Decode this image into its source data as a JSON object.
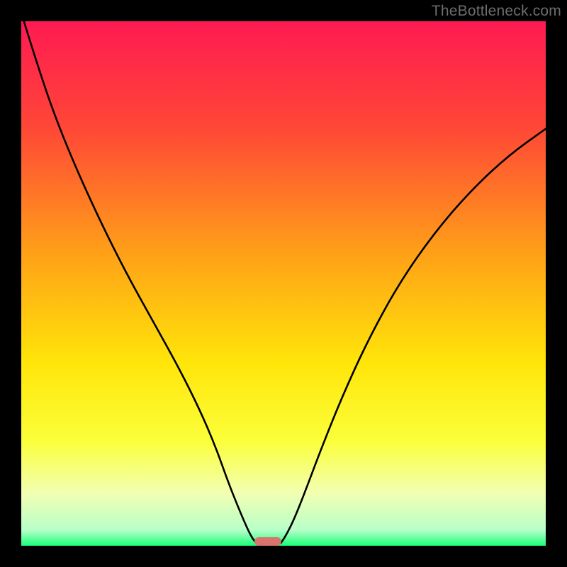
{
  "watermark": "TheBottleneck.com",
  "chart_data": {
    "type": "line",
    "title": "",
    "xlabel": "",
    "ylabel": "",
    "xlim": [
      0,
      100
    ],
    "ylim": [
      0,
      100
    ],
    "gradient_stops": [
      {
        "pct": 0,
        "color": "#ff1a52"
      },
      {
        "pct": 20,
        "color": "#ff4637"
      },
      {
        "pct": 45,
        "color": "#ffa317"
      },
      {
        "pct": 65,
        "color": "#ffe509"
      },
      {
        "pct": 80,
        "color": "#fbff3a"
      },
      {
        "pct": 90,
        "color": "#f2ffb3"
      },
      {
        "pct": 97,
        "color": "#b8ffc9"
      },
      {
        "pct": 100,
        "color": "#19ff79"
      }
    ],
    "series": [
      {
        "name": "left-branch",
        "x": [
          0.5,
          3,
          6,
          10,
          15,
          20,
          25,
          30,
          34,
          37,
          39.5,
          41.5,
          43,
          44,
          44.8
        ],
        "y": [
          100,
          92,
          83,
          73,
          62,
          52,
          43,
          34,
          26,
          19,
          12,
          7,
          3.5,
          1.5,
          0.5
        ]
      },
      {
        "name": "right-branch",
        "x": [
          49.5,
          50.5,
          52,
          54,
          57,
          61,
          66,
          72,
          79,
          86,
          93,
          100
        ],
        "y": [
          0.5,
          2,
          5,
          10,
          18,
          28,
          39,
          50,
          60,
          68,
          74.5,
          79.5
        ]
      }
    ],
    "marker": {
      "label": "bottleneck-point",
      "x": 47,
      "width_pct": 5.2,
      "height_pct": 1.6,
      "color": "#d9736d"
    }
  }
}
